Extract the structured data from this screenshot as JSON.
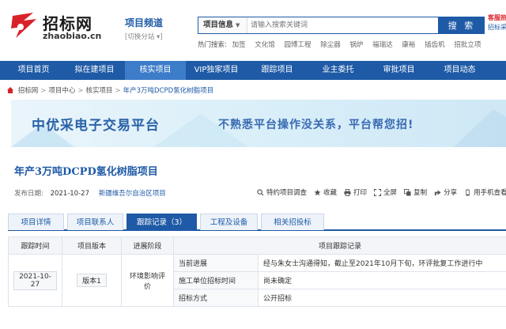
{
  "header": {
    "logo_cn": "招标网",
    "logo_en": "zhaobiao.cn",
    "channel_title": "项目频道",
    "channel_switch": "[切换分站 ▾]",
    "search_category": "项目信息",
    "search_placeholder": "请输入搜索关键词",
    "search_button": "搜 索",
    "service_line1": "客服热线",
    "service_line2": "招标采购",
    "hot_label": "热门搜索:",
    "hot_words": [
      "加签",
      "文化馆",
      "园博工程",
      "除尘器",
      "锅炉",
      "福瑞达",
      "康裕",
      "插齿机",
      "招批立项"
    ]
  },
  "nav": {
    "items": [
      "项目首页",
      "拟在建项目",
      "核实项目",
      "VIP独家项目",
      "跟踪项目",
      "业主委托",
      "审批项目",
      "项目动态"
    ],
    "active_index": 2
  },
  "breadcrumb": {
    "items": [
      "招标网",
      "项目中心",
      "核实项目"
    ],
    "current": "年产3万吨DCPD氢化树脂项目"
  },
  "banner": {
    "left_text": "中优采电子交易平台",
    "right_text": "不熟悉平台操作没关系，平台帮您招!"
  },
  "project": {
    "title": "年产3万吨DCPD氢化树脂项目",
    "pub_label": "发布日期:",
    "pub_date": "2021-10-27",
    "region": "新疆维吾尔自治区项目"
  },
  "actions": [
    "特约项目调查",
    "收藏",
    "打印",
    "全屏",
    "复制",
    "分享",
    "用手机查看"
  ],
  "tabs": [
    {
      "label": "项目详情"
    },
    {
      "label": "项目联系人"
    },
    {
      "label": "跟踪记录（3）"
    },
    {
      "label": "工程及设备"
    },
    {
      "label": "相关招投标"
    }
  ],
  "active_tab": 2,
  "table": {
    "headers": [
      "跟踪时间",
      "项目版本",
      "进展阶段",
      "项目跟踪记录"
    ],
    "date": "2021-10-27",
    "version": "版本1",
    "stage": "环境影响评价",
    "rows": [
      {
        "label": "当前进展",
        "value": "经与朱女士沟通得知，截止至2021年10月下旬，环评批复工作进行中"
      },
      {
        "label": "施工单位招标时间",
        "value": "尚未确定"
      },
      {
        "label": "招标方式",
        "value": "公开招标"
      }
    ]
  },
  "colors": {
    "brand_blue": "#1e5aa6",
    "logo_red": "#d8222a"
  }
}
